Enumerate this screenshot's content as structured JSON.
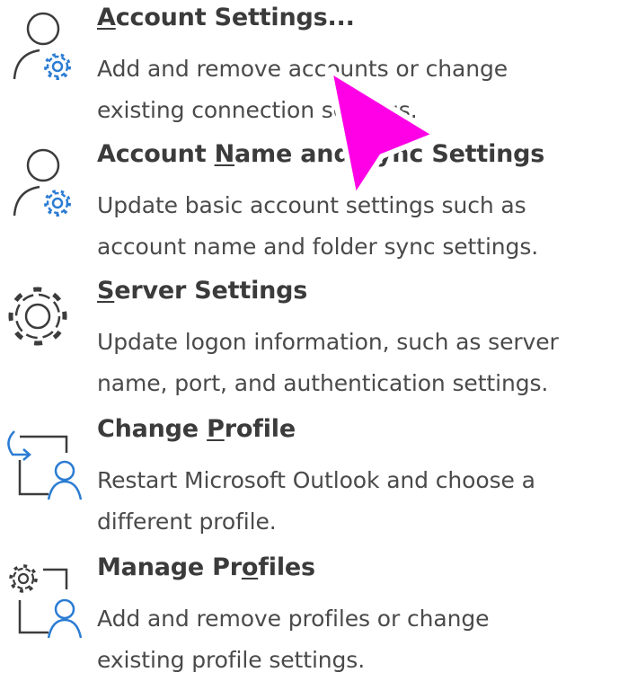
{
  "menu": {
    "items": [
      {
        "title_pre": "",
        "title_key": "A",
        "title_post": "ccount Settings...",
        "line1": "Add and remove accounts or change",
        "line2": "existing connection settings.",
        "icon": "account-gear-icon"
      },
      {
        "title_pre": "Account ",
        "title_key": "N",
        "title_post": "ame and Sync Settings",
        "line1": "Update basic account settings such as",
        "line2": "account name and folder sync settings.",
        "icon": "account-gear-icon"
      },
      {
        "title_pre": "",
        "title_key": "S",
        "title_post": "erver Settings",
        "line1": "Update logon information, such as server",
        "line2": "name, port, and authentication settings.",
        "icon": "gear-icon"
      },
      {
        "title_pre": "Change ",
        "title_key": "P",
        "title_post": "rofile",
        "line1": "Restart Microsoft Outlook and choose a",
        "line2": "different profile.",
        "icon": "change-profile-icon"
      },
      {
        "title_pre": "Manage Pr",
        "title_key": "o",
        "title_post": "files",
        "line1": "Add and remove profiles or change",
        "line2": "existing profile settings.",
        "icon": "manage-profiles-icon"
      }
    ]
  },
  "colors": {
    "accent": "#2b7cd3",
    "icon_gray": "#3c3c3c",
    "cursor": "#ff00e6"
  },
  "cursor_icon": "pointer-arrow-icon"
}
